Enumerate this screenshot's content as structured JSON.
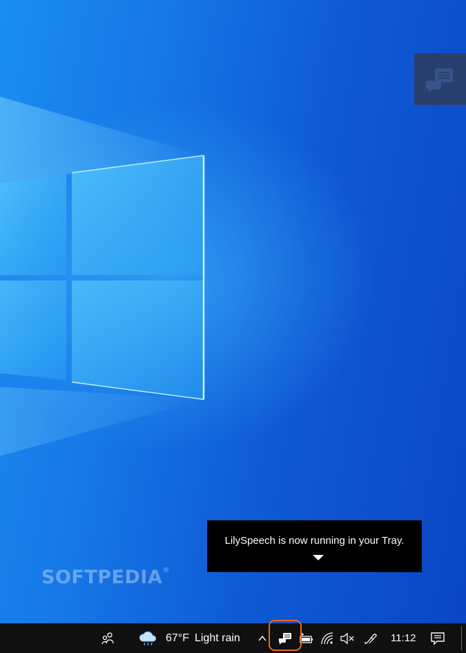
{
  "watermark": "SOFTPEDIA",
  "watermark_mark": "®",
  "tooltip": {
    "message": "LilySpeech is now running in your Tray.",
    "caret_icon": "caret-down-icon"
  },
  "side_widget": {
    "icon": "speech-bubbles-icon"
  },
  "taskbar": {
    "people_icon": "people-icon",
    "weather": {
      "icon": "cloud-rain-icon",
      "temperature": "67°F",
      "condition": "Light rain"
    },
    "show_hidden_icon": "chevron-up-icon",
    "tray_icons": [
      "lilyspeech-icon",
      "battery-icon",
      "wifi-icon",
      "volume-muted-icon",
      "pen-icon"
    ],
    "clock": "11:12",
    "notifications_icon": "notifications-icon"
  },
  "colors": {
    "desktop_light": "#1a8ef0",
    "desktop_dark": "#0a46c4",
    "taskbar": "#101010",
    "tooltip": "#000000",
    "highlight": "#f06a1c",
    "side_widget": "#2a3f66"
  }
}
